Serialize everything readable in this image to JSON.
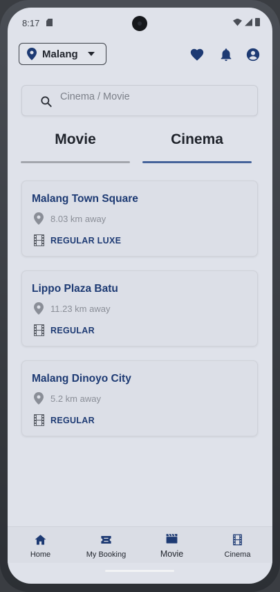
{
  "status_bar": {
    "time": "8:17"
  },
  "header": {
    "location": "Malang",
    "icons": [
      "heart-icon",
      "bell-icon",
      "account-icon"
    ]
  },
  "search": {
    "placeholder": "Cinema / Movie",
    "value": ""
  },
  "tabs": [
    {
      "label": "Movie",
      "selected": false
    },
    {
      "label": "Cinema",
      "selected": true
    }
  ],
  "cinemas": [
    {
      "name": "Malang Town Square",
      "distance": "8.03 km away",
      "type": "REGULAR LUXE"
    },
    {
      "name": "Lippo Plaza Batu",
      "distance": "11.23 km away",
      "type": "REGULAR"
    },
    {
      "name": "Malang Dinoyo City",
      "distance": "5.2 km away",
      "type": "REGULAR"
    }
  ],
  "bottom_nav": [
    {
      "label": "Home",
      "icon": "home-icon"
    },
    {
      "label": "My Booking",
      "icon": "ticket-icon"
    },
    {
      "label": "Movie",
      "icon": "clapperboard-icon"
    },
    {
      "label": "Cinema",
      "icon": "film-icon"
    }
  ],
  "colors": {
    "accent": "#1d3a73",
    "tab_indicator": "#45639a",
    "background": "#dfe2ea"
  }
}
